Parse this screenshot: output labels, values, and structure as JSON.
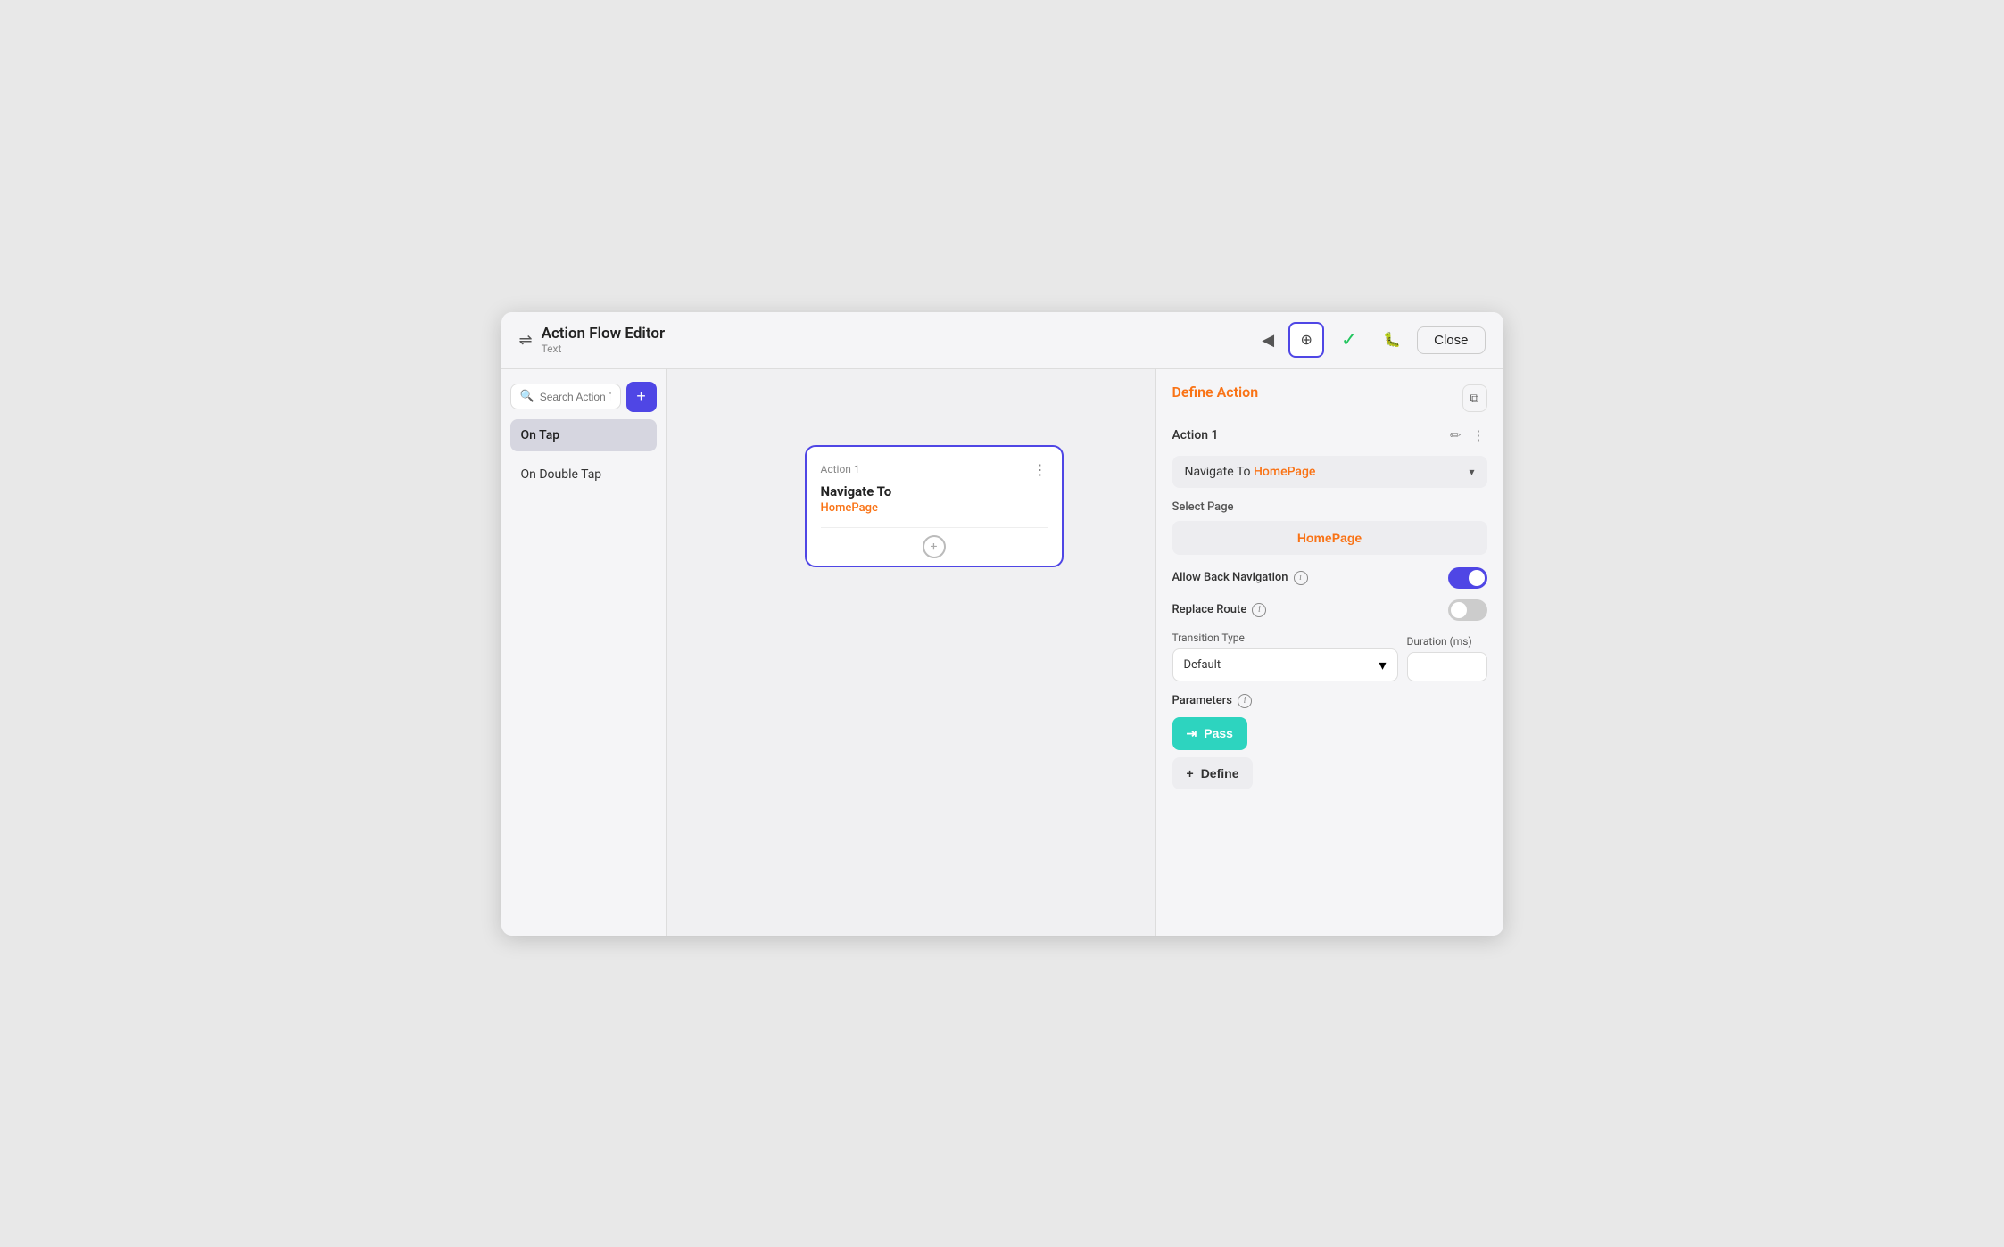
{
  "header": {
    "title": "Action Flow Editor",
    "subtitle": "Text",
    "close_label": "Close"
  },
  "sidebar": {
    "search_placeholder": "Search Action Triggers...",
    "triggers": [
      {
        "label": "On Tap",
        "active": true
      },
      {
        "label": "On Double Tap",
        "active": false
      }
    ]
  },
  "canvas": {
    "action_card": {
      "label": "Action 1",
      "title": "Navigate To",
      "subtitle": "HomePage"
    }
  },
  "right_panel": {
    "title": "Define Action",
    "action_name": "Action 1",
    "action_dropdown": {
      "prefix": "Navigate To ",
      "highlight": "HomePage"
    },
    "select_page_label": "Select Page",
    "select_page_value": "HomePage",
    "allow_back_navigation": {
      "label": "Allow Back Navigation",
      "enabled": true
    },
    "replace_route": {
      "label": "Replace Route",
      "enabled": false
    },
    "transition_type": {
      "label": "Transition Type",
      "value": "Default"
    },
    "duration": {
      "label": "Duration (ms)",
      "value": ""
    },
    "parameters": {
      "label": "Parameters",
      "pass_label": "Pass",
      "define_label": "Define"
    }
  },
  "icons": {
    "search": "🔍",
    "plus": "+",
    "collapse": "◀",
    "dots_vertical": "⋮",
    "chevron_down": "▾",
    "pencil": "✏",
    "copy": "⧉",
    "info": "i",
    "arrow_down": "⌄",
    "pass_icon": "⇥",
    "define_icon": "+",
    "check": "✓",
    "bug": "🐛",
    "cursor": "⊕"
  }
}
